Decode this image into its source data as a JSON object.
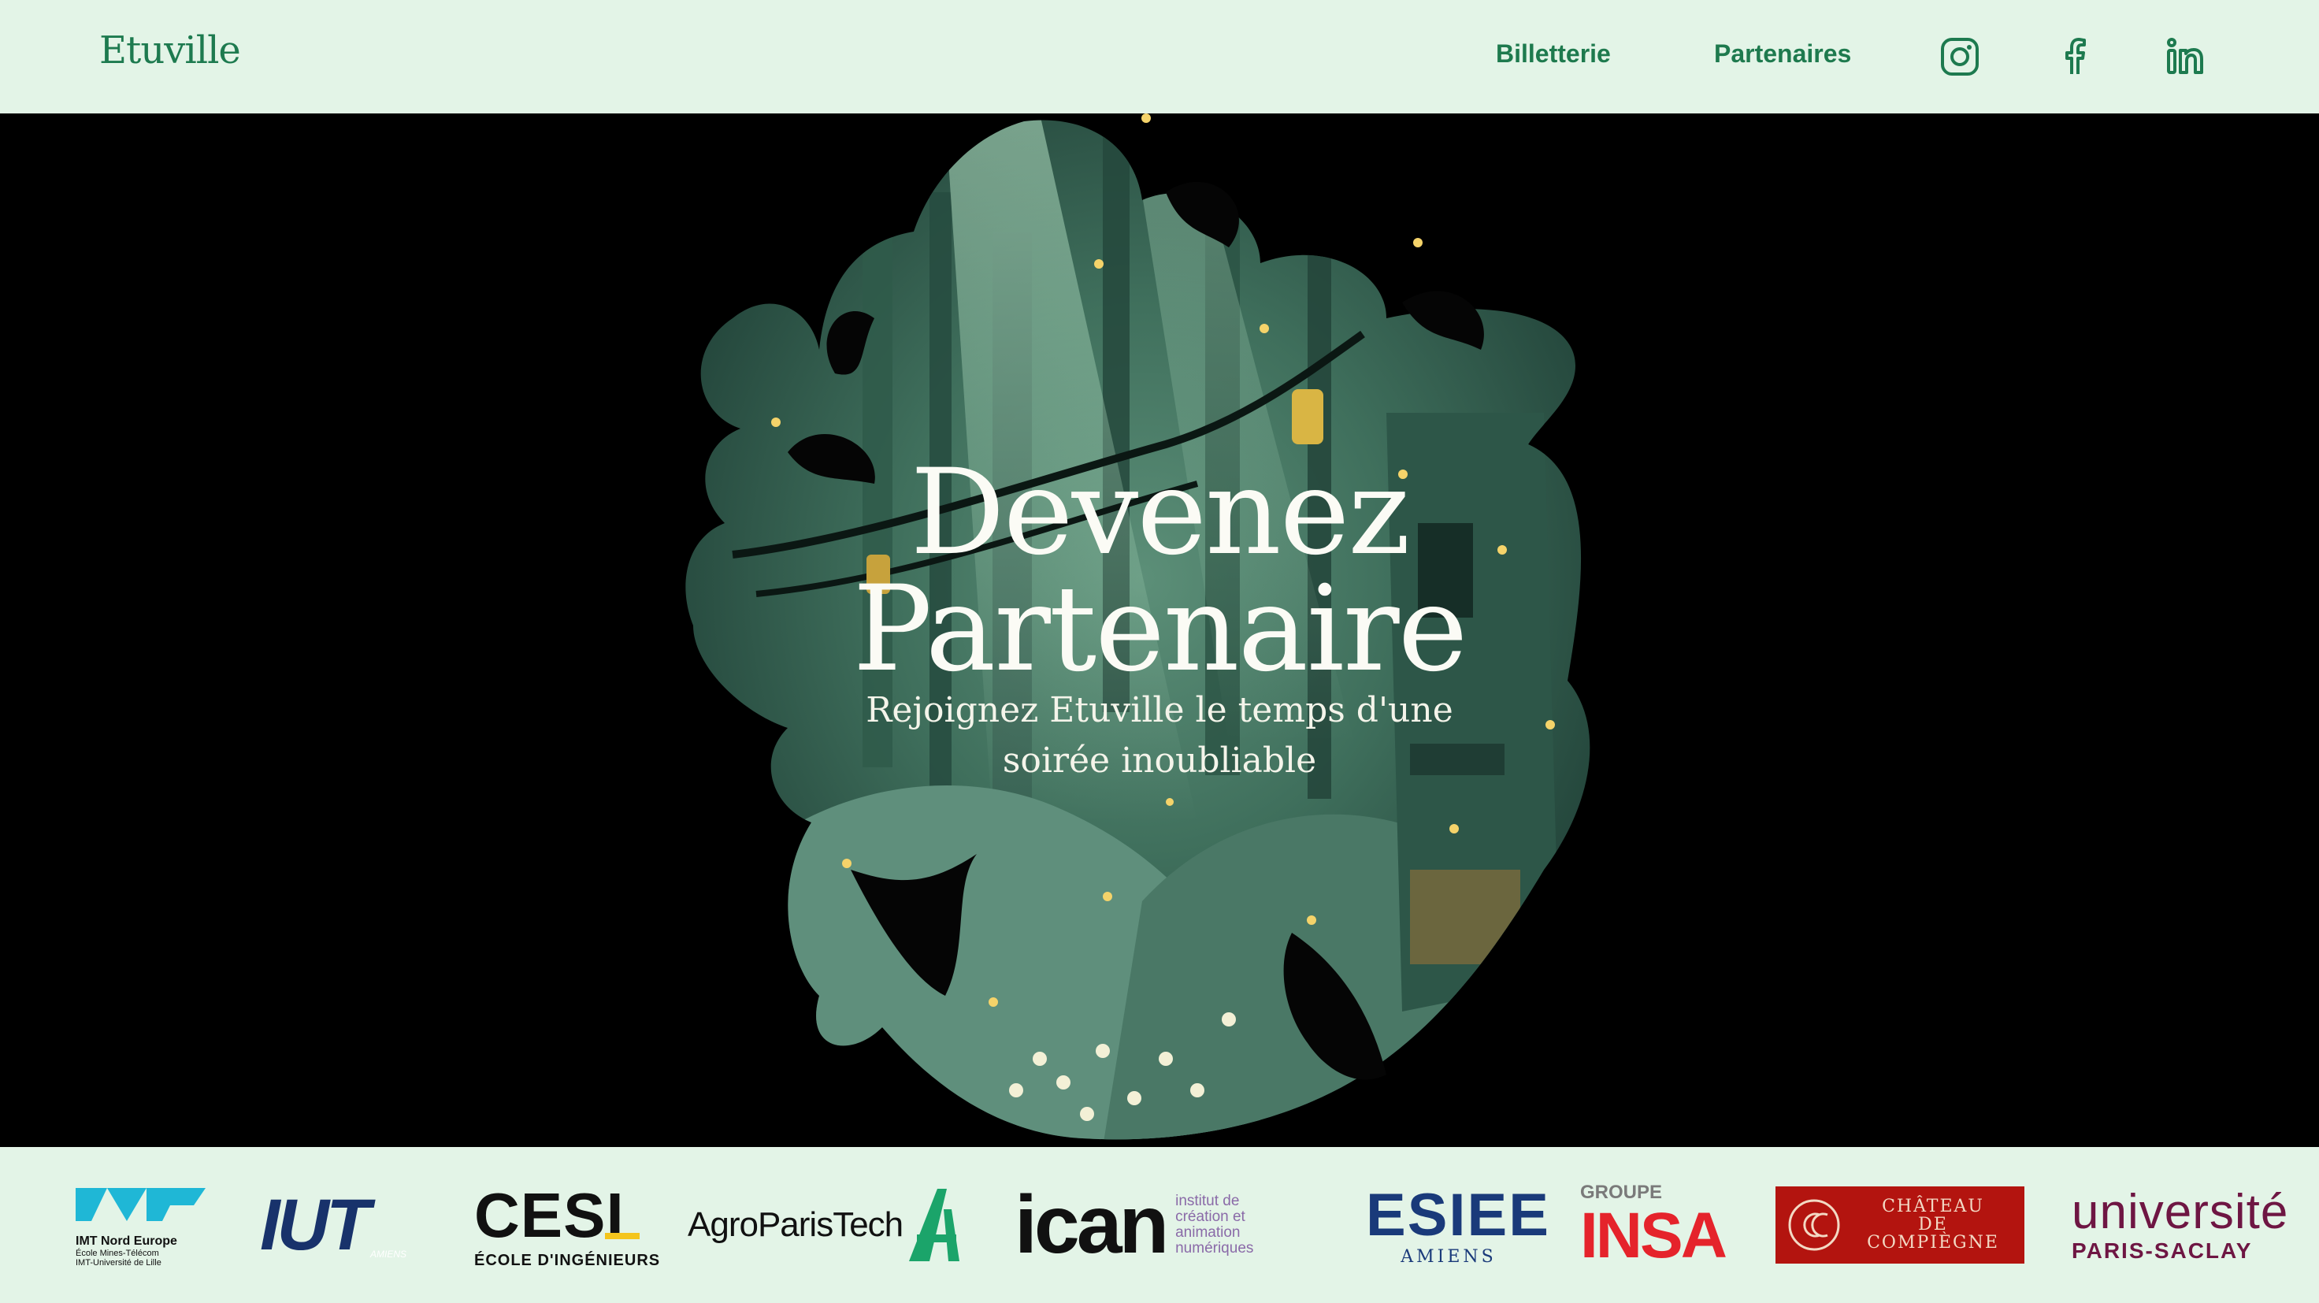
{
  "header": {
    "brand": "Etuville",
    "nav": [
      {
        "label": "Billetterie"
      },
      {
        "label": "Partenaires"
      }
    ],
    "social": [
      "instagram-icon",
      "facebook-icon",
      "linkedin-icon"
    ]
  },
  "hero": {
    "title_line1": "Devenez",
    "title_line2": "Partenaire",
    "subtitle": "Rejoignez Etuville le temps d'une soirée inoubliable"
  },
  "partners": {
    "imt": {
      "name": "IMT Nord Europe",
      "line1": "École Mines-Télécom",
      "line2": "IMT-Université de Lille"
    },
    "iut": {
      "name": "IUT",
      "sub": "AMIENS"
    },
    "cesi": {
      "name": "CESI",
      "sub": "ÉCOLE D'INGÉNIEURS"
    },
    "agro": {
      "name": "AgroParisTech"
    },
    "ican": {
      "name": "ican",
      "l1": "institut de",
      "l2": "création et",
      "l3": "animation",
      "l4": "numériques"
    },
    "esiee": {
      "name": "ESIEE",
      "sub": "AMIENS"
    },
    "insa": {
      "top": "GROUPE",
      "name": "INSA"
    },
    "chateau": {
      "l1": "CHÂTEAU",
      "l2": "DE",
      "l3": "COMPIÈGNE"
    },
    "saclay": {
      "name": "université",
      "sub": "PARIS-SACLAY"
    }
  },
  "colors": {
    "header_bg": "#e3f4e7",
    "brand_green": "#1d7a4f",
    "hero_bg": "#000000"
  }
}
